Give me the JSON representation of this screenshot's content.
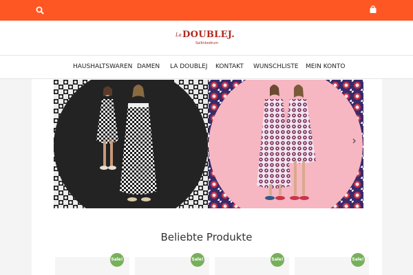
{
  "topbar": {
    "color": "#fe5723",
    "search_icon": "search-icon",
    "cart_icon": "shopping-bag-icon"
  },
  "logo": {
    "prefix": "La",
    "brand": "DOUBLEJ.",
    "subtitle": "Sailinbodrum",
    "color": "#b3261e"
  },
  "nav": {
    "items": [
      {
        "label": "HAUSHALTSWAREN"
      },
      {
        "label": "DAMEN"
      },
      {
        "label": "LA DOUBLEJ"
      },
      {
        "label": "KONTAKT"
      },
      {
        "label": "WUNSCHLISTE"
      },
      {
        "label": "MEIN KONTO"
      }
    ]
  },
  "slider": {
    "next_icon": "chevron-right-icon"
  },
  "section": {
    "title": "Beliebte Produkte"
  },
  "products": {
    "badge_color": "#77b05a",
    "items": [
      {
        "badge": "Sale!"
      },
      {
        "badge": "Sale!"
      },
      {
        "badge": "Sale!"
      },
      {
        "badge": "Sale!"
      }
    ]
  }
}
